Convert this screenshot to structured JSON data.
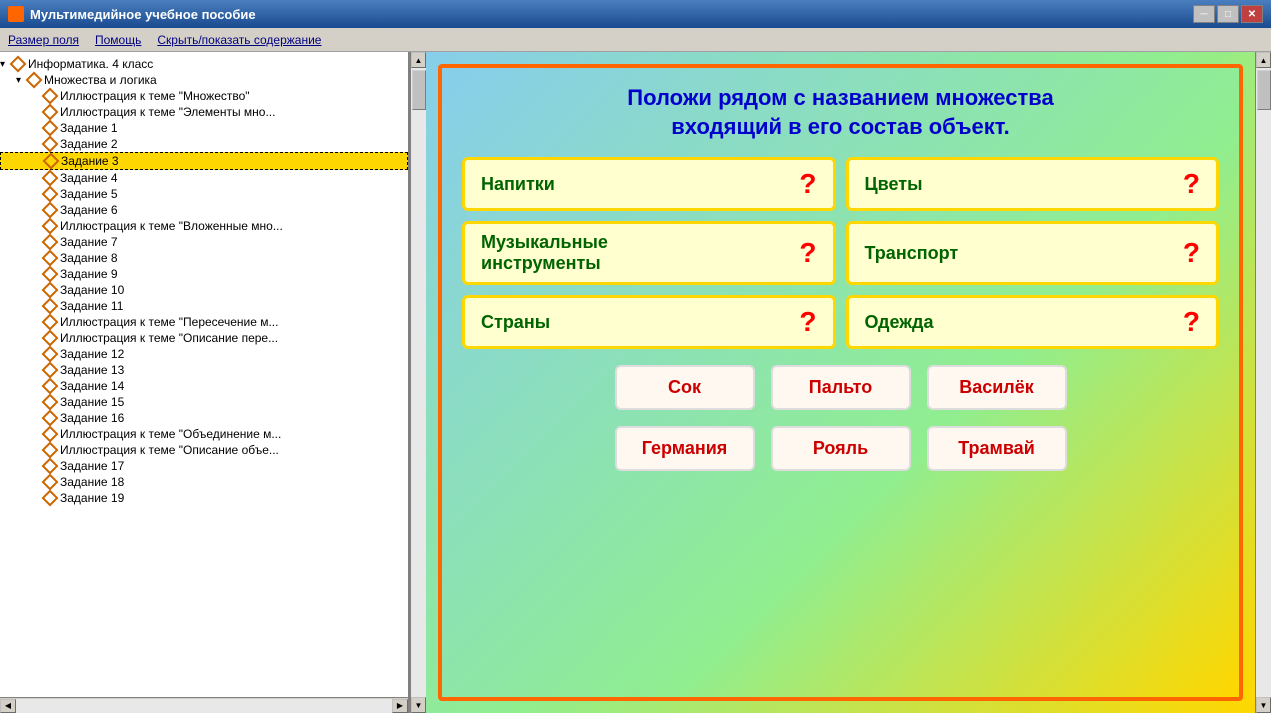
{
  "titleBar": {
    "title": "Мультимедийное учебное пособие",
    "iconLabel": "app-icon",
    "controls": [
      "minimize",
      "maximize",
      "close"
    ]
  },
  "menuBar": {
    "items": [
      {
        "id": "size",
        "label": "Размер поля"
      },
      {
        "id": "help",
        "label": "Помощь"
      },
      {
        "id": "toggle",
        "label": "Скрыть/показать содержание"
      }
    ]
  },
  "sidebar": {
    "tree": [
      {
        "id": "root",
        "level": 0,
        "label": "Информатика. 4 класс",
        "expanded": true,
        "type": "branch"
      },
      {
        "id": "sets",
        "level": 1,
        "label": "Множества и логика",
        "expanded": true,
        "type": "branch"
      },
      {
        "id": "illus1",
        "level": 2,
        "label": "Иллюстрация к теме \"Множество\"",
        "type": "leaf"
      },
      {
        "id": "illus2",
        "level": 2,
        "label": "Иллюстрация к теме \"Элементы мно...",
        "type": "leaf"
      },
      {
        "id": "task1",
        "level": 2,
        "label": "Задание 1",
        "type": "leaf"
      },
      {
        "id": "task2",
        "level": 2,
        "label": "Задание 2",
        "type": "leaf"
      },
      {
        "id": "task3",
        "level": 2,
        "label": "Задание 3",
        "type": "leaf",
        "selected": true
      },
      {
        "id": "task4",
        "level": 2,
        "label": "Задание 4",
        "type": "leaf"
      },
      {
        "id": "task5",
        "level": 2,
        "label": "Задание 5",
        "type": "leaf"
      },
      {
        "id": "task6",
        "level": 2,
        "label": "Задание 6",
        "type": "leaf"
      },
      {
        "id": "illus3",
        "level": 2,
        "label": "Иллюстрация к теме \"Вложенные мно...",
        "type": "leaf"
      },
      {
        "id": "task7",
        "level": 2,
        "label": "Задание 7",
        "type": "leaf"
      },
      {
        "id": "task8",
        "level": 2,
        "label": "Задание 8",
        "type": "leaf"
      },
      {
        "id": "task9",
        "level": 2,
        "label": "Задание 9",
        "type": "leaf"
      },
      {
        "id": "task10",
        "level": 2,
        "label": "Задание 10",
        "type": "leaf"
      },
      {
        "id": "task11",
        "level": 2,
        "label": "Задание 11",
        "type": "leaf"
      },
      {
        "id": "illus4",
        "level": 2,
        "label": "Иллюстрация к теме \"Пересечение м...",
        "type": "leaf"
      },
      {
        "id": "illus5",
        "level": 2,
        "label": "Иллюстрация к теме \"Описание пере...",
        "type": "leaf"
      },
      {
        "id": "task12",
        "level": 2,
        "label": "Задание 12",
        "type": "leaf"
      },
      {
        "id": "task13",
        "level": 2,
        "label": "Задание 13",
        "type": "leaf"
      },
      {
        "id": "task14",
        "level": 2,
        "label": "Задание 14",
        "type": "leaf"
      },
      {
        "id": "task15",
        "level": 2,
        "label": "Задание 15",
        "type": "leaf"
      },
      {
        "id": "task16",
        "level": 2,
        "label": "Задание 16",
        "type": "leaf"
      },
      {
        "id": "illus6",
        "level": 2,
        "label": "Иллюстрация к теме \"Объединение м...",
        "type": "leaf"
      },
      {
        "id": "illus7",
        "level": 2,
        "label": "Иллюстрация к теме \"Описание объе...",
        "type": "leaf"
      },
      {
        "id": "task17",
        "level": 2,
        "label": "Задание 17",
        "type": "leaf"
      },
      {
        "id": "task18",
        "level": 2,
        "label": "Задание 18",
        "type": "leaf"
      },
      {
        "id": "task19",
        "level": 2,
        "label": "Задание 19",
        "type": "leaf"
      }
    ]
  },
  "slide": {
    "title": "Положи рядом с названием множества\nвходящий в его состав объект.",
    "categories": [
      [
        {
          "name": "Напитки",
          "hasQuestion": true
        },
        {
          "name": "Цветы",
          "hasQuestion": true
        }
      ],
      [
        {
          "name": "Музыкальные инструменты",
          "hasQuestion": true
        },
        {
          "name": "Транспорт",
          "hasQuestion": true
        }
      ],
      [
        {
          "name": "Страны",
          "hasQuestion": true
        },
        {
          "name": "Одежда",
          "hasQuestion": true
        }
      ]
    ],
    "answers": [
      [
        {
          "id": "sok",
          "label": "Сок"
        },
        {
          "id": "palto",
          "label": "Пальто"
        },
        {
          "id": "vasilek",
          "label": "Василёк"
        }
      ],
      [
        {
          "id": "germania",
          "label": "Германия"
        },
        {
          "id": "royal",
          "label": "Рояль"
        },
        {
          "id": "tramvay",
          "label": "Трамвай"
        }
      ]
    ],
    "questionMark": "?"
  }
}
